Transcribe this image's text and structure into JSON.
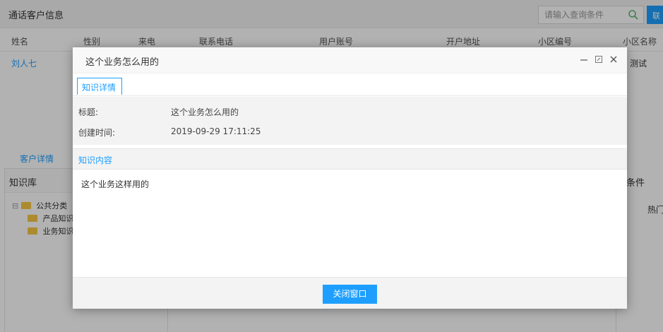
{
  "app": {
    "title": "通话客户信息",
    "search_placeholder": "请输入查询条件",
    "search_button": "联"
  },
  "grid": {
    "columns": [
      "姓名",
      "性别",
      "来电",
      "联系电话",
      "用户账号",
      "开户地址",
      "小区编号",
      "小区名称"
    ],
    "rows": [
      [
        "刘人七",
        "",
        "",
        "",
        "",
        "",
        "",
        "测试"
      ]
    ]
  },
  "lower": {
    "customer_tab": "客户详情",
    "kb_title": "知识库",
    "tree": [
      "公共分类",
      "产品知识",
      "业务知识"
    ],
    "cond_label": "条件",
    "hot_label": "热门"
  },
  "modal": {
    "title": "这个业务怎么用的",
    "tab_label": "知识详情",
    "fields": [
      {
        "label": "标题:",
        "value": "这个业务怎么用的"
      },
      {
        "label": "创建时间:",
        "value": "2019-09-29 17:11:25"
      }
    ],
    "content_header": "知识内容",
    "content_text": "这个业务这样用的",
    "close_button": "关闭窗口"
  },
  "colors": {
    "accent": "#1e9fff",
    "overlay": "rgba(0,0,0,0.30)"
  }
}
